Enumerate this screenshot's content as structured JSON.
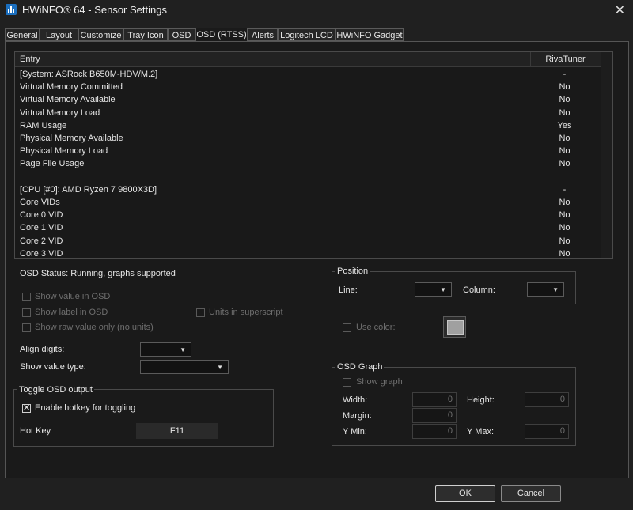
{
  "window": {
    "title": "HWiNFO® 64 - Sensor Settings",
    "close_glyph": "✕",
    "icon": "hwinfo-app-icon"
  },
  "tabs": [
    {
      "label": "General"
    },
    {
      "label": "Layout"
    },
    {
      "label": "Customize"
    },
    {
      "label": "Tray Icon"
    },
    {
      "label": "OSD"
    },
    {
      "label": "OSD (RTSS)",
      "active": true
    },
    {
      "label": "Alerts"
    },
    {
      "label": "Logitech LCD"
    },
    {
      "label": "HWiNFO Gadget"
    }
  ],
  "list": {
    "columns": {
      "entry": "Entry",
      "rivatuner": "RivaTuner"
    },
    "rows": [
      {
        "name": "[System: ASRock B650M-HDV/M.2]",
        "value": "-"
      },
      {
        "name": "Virtual Memory Committed",
        "value": "No"
      },
      {
        "name": "Virtual Memory Available",
        "value": "No"
      },
      {
        "name": "Virtual Memory Load",
        "value": "No"
      },
      {
        "name": "RAM Usage",
        "value": "Yes"
      },
      {
        "name": "Physical Memory Available",
        "value": "No"
      },
      {
        "name": "Physical Memory Load",
        "value": "No"
      },
      {
        "name": "Page File Usage",
        "value": "No"
      },
      {
        "name": "",
        "value": ""
      },
      {
        "name": "[CPU [#0]: AMD Ryzen 7 9800X3D]",
        "value": "-"
      },
      {
        "name": "Core VIDs",
        "value": "No"
      },
      {
        "name": "Core 0 VID",
        "value": "No"
      },
      {
        "name": "Core 1 VID",
        "value": "No"
      },
      {
        "name": "Core 2 VID",
        "value": "No"
      },
      {
        "name": "Core 3 VID",
        "value": "No"
      }
    ]
  },
  "osd": {
    "status": "OSD Status: Running, graphs supported",
    "show_value": "Show value in OSD",
    "show_label": "Show label in OSD",
    "units_superscript": "Units in superscript",
    "show_raw": "Show raw value only (no units)",
    "align_digits": "Align digits:",
    "show_value_type": "Show value type:"
  },
  "toggle": {
    "title": "Toggle OSD output",
    "enable_hotkey": "Enable hotkey for toggling",
    "enable_hotkey_checked": true,
    "hotkey_label": "Hot Key",
    "hotkey_value": "F11"
  },
  "position": {
    "title": "Position",
    "line": "Line:",
    "column": "Column:",
    "use_color": "Use color:",
    "swatch_color": "#a0a0a0"
  },
  "graph": {
    "title": "OSD Graph",
    "show_graph": "Show graph",
    "width_label": "Width:",
    "width_value": "0",
    "height_label": "Height:",
    "height_value": "0",
    "margin_label": "Margin:",
    "margin_value": "0",
    "ymin_label": "Y Min:",
    "ymin_value": "0",
    "ymax_label": "Y Max:",
    "ymax_value": "0"
  },
  "footer": {
    "ok": "OK",
    "cancel": "Cancel"
  }
}
